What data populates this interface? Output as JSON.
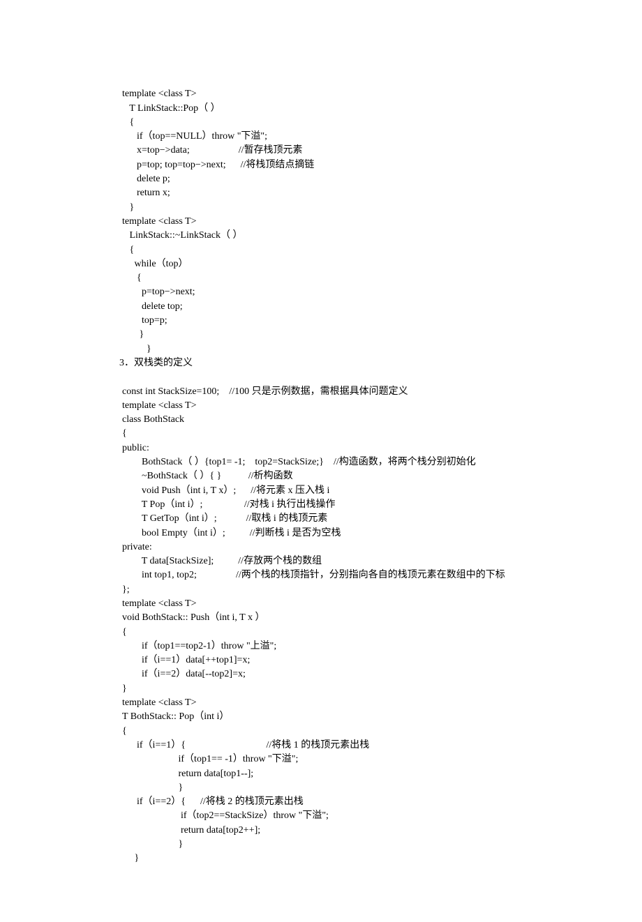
{
  "code_block_1": "template <class T>\n   T LinkStack::Pop（ ）\n   {\n      if（top==NULL）throw \"下溢\";\n      x=top−>data;                    //暂存栈顶元素\n      p=top; top=top−>next;      //将栈顶结点摘链\n      delete p;\n      return x;\n   }\ntemplate <class T>\n   LinkStack::~LinkStack（ ）\n   {\n     while（top）\n      {\n        p=top−>next;\n        delete top;\n        top=p;\n       }\n          }",
  "heading": "3．双栈类的定义",
  "code_block_2": "const int StackSize=100;    //100 只是示例数据，需根据具体问题定义\ntemplate <class T>\nclass BothStack\n{\npublic:\n        BothStack（ ）{top1= -1;    top2=StackSize;}    //构造函数，将两个栈分别初始化\n        ~BothStack（ ）{ }           //析构函数\n        void Push（int i, T x）;      //将元素 x 压入栈 i\n        T Pop（int i）;                 //对栈 i 执行出栈操作\n        T GetTop（int i）;            //取栈 i 的栈顶元素\n        bool Empty（int i）;          //判断栈 i 是否为空栈\nprivate:\n        T data[StackSize];          //存放两个栈的数组\n        int top1, top2;                //两个栈的栈顶指针，分别指向各自的栈顶元素在数组中的下标\n};\ntemplate <class T>\nvoid BothStack:: Push（int i, T x ）\n{\n        if（top1==top2-1）throw \"上溢\";\n        if（i==1）data[++top1]=x;\n        if（i==2）data[--top2]=x;\n}\ntemplate <class T>\nT BothStack:: Pop（int i）\n{\n      if（i==1）{                                 //将栈 1 的栈顶元素出栈\n                       if（top1== -1）throw \"下溢\";\n                       return data[top1--];\n                       }\n      if（i==2）{      //将栈 2 的栈顶元素出栈\n                        if（top2==StackSize）throw \"下溢\";\n                        return data[top2++];\n                       }\n     }"
}
